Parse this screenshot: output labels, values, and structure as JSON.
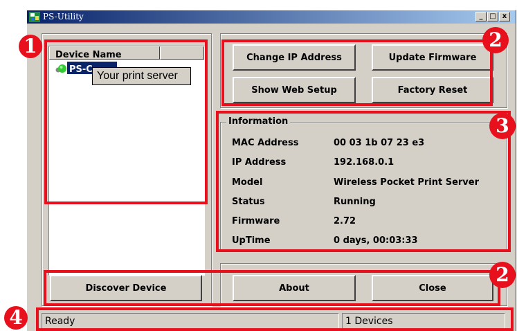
{
  "window": {
    "title": "PS-Utility",
    "controls": [
      "_",
      "□",
      "x"
    ]
  },
  "device_list": {
    "header": "Device Name",
    "selected_item": "PS-C",
    "tooltip": "Your print server"
  },
  "top_buttons": {
    "change_ip": "Change IP Address",
    "update_firmware": "Update Firmware",
    "show_web_setup": "Show Web Setup",
    "factory_reset": "Factory Reset"
  },
  "information": {
    "title": "Information",
    "rows": [
      {
        "label": "MAC Address",
        "value": "00 03 1b 07 23 e3"
      },
      {
        "label": "IP Address",
        "value": "192.168.0.1"
      },
      {
        "label": "Model",
        "value": "Wireless Pocket Print Server"
      },
      {
        "label": "Status",
        "value": "Running"
      },
      {
        "label": "Firmware",
        "value": "2.72"
      },
      {
        "label": "UpTime",
        "value": "0 days, 00:03:33"
      }
    ]
  },
  "bottom_buttons": {
    "discover": "Discover Device",
    "about": "About",
    "close": "Close"
  },
  "status_bar": {
    "left": "Ready",
    "right": "1 Devices"
  },
  "badges": {
    "one": "1",
    "two_top": "2",
    "three": "3",
    "two_bottom": "2",
    "four": "4"
  },
  "colors": {
    "annotation_red": "#e8101c",
    "title_bar": "#0a246a",
    "window_face": "#d4d0c8"
  }
}
